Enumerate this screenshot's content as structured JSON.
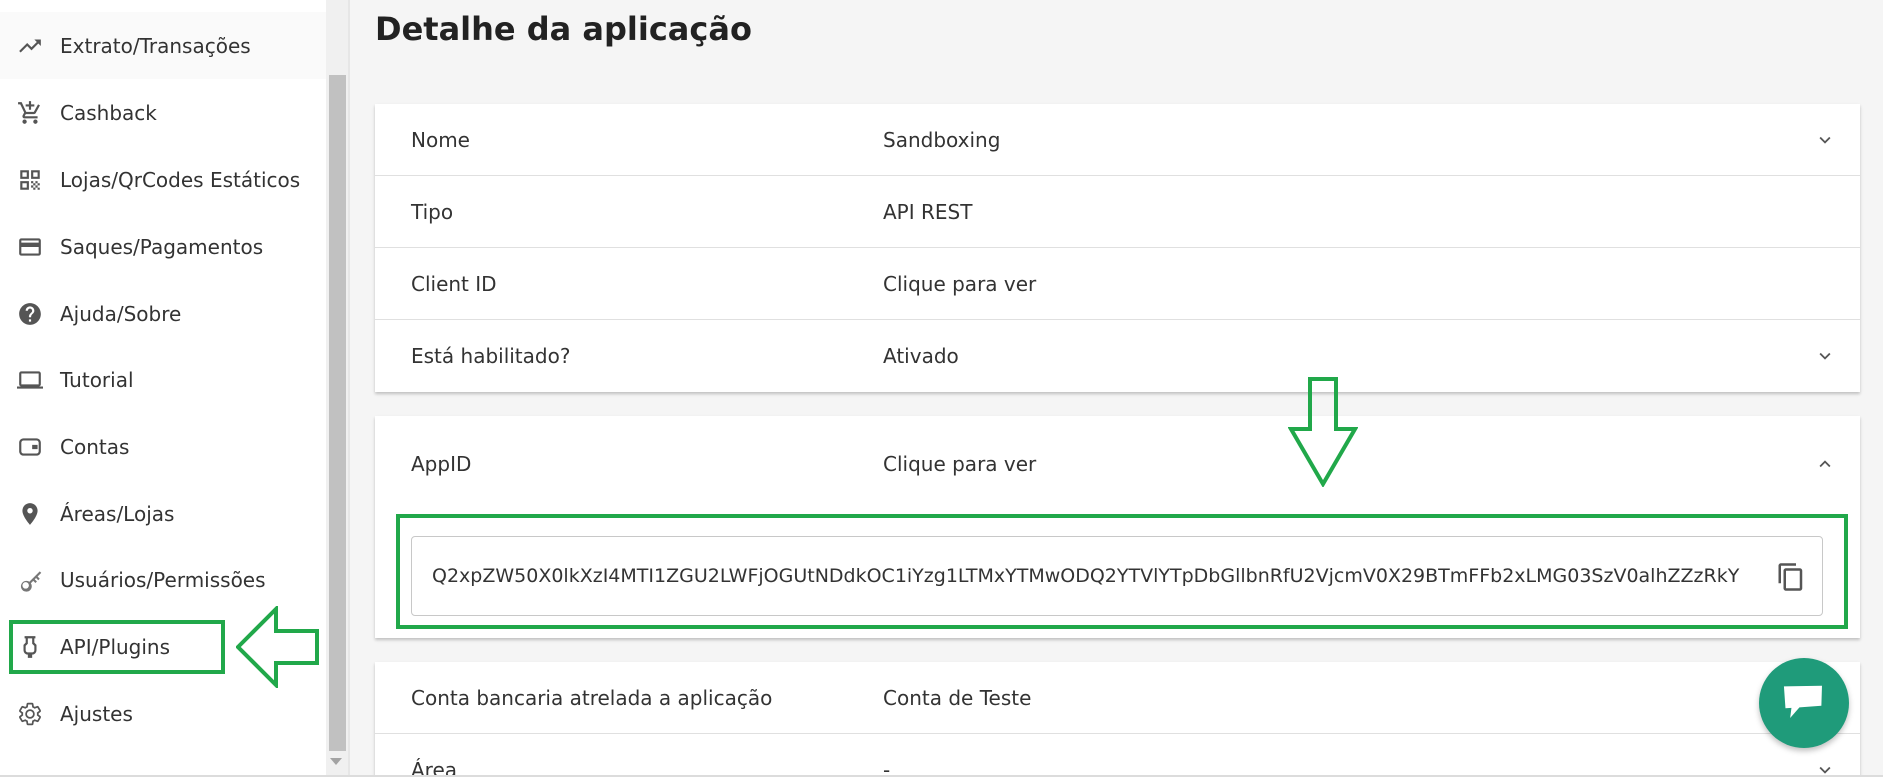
{
  "sidebar": {
    "items": [
      {
        "label": "Extrato/Transações",
        "icon": "trending-up-icon"
      },
      {
        "label": "Cashback",
        "icon": "cart-add-icon"
      },
      {
        "label": "Lojas/QrCodes Estáticos",
        "icon": "qr-code-icon"
      },
      {
        "label": "Saques/Pagamentos",
        "icon": "credit-card-icon"
      },
      {
        "label": "Ajuda/Sobre",
        "icon": "help-circle-icon"
      },
      {
        "label": "Tutorial",
        "icon": "laptop-icon"
      },
      {
        "label": "Contas",
        "icon": "wallet-icon"
      },
      {
        "label": "Áreas/Lojas",
        "icon": "location-pin-icon"
      },
      {
        "label": "Usuários/Permissões",
        "icon": "key-icon"
      },
      {
        "label": "API/Plugins",
        "icon": "plug-icon"
      },
      {
        "label": "Ajustes",
        "icon": "gear-icon"
      }
    ]
  },
  "main": {
    "title": "Detalhe da aplicação",
    "card1": {
      "rows": [
        {
          "label": "Nome",
          "value": "Sandboxing"
        },
        {
          "label": "Tipo",
          "value": "API REST"
        },
        {
          "label": "Client ID",
          "value": "Clique para ver"
        },
        {
          "label": "Está habilitado?",
          "value": "Ativado"
        }
      ]
    },
    "card2": {
      "label": "AppID",
      "value": "Clique para ver",
      "appid_value": "Q2xpZW50X0lkXzI4MTI1ZGU2LWFjOGUtNDdkOC1iYzg1LTMxYTMwODQ2YTVlYTpDbGllbnRfU2VjcmV0X29BTmFFb2xLMG03SzV0alhZZzRkY"
    },
    "card3": {
      "rows": [
        {
          "label": "Conta bancaria atrelada a aplicação",
          "value": "Conta de Teste"
        },
        {
          "label": "Área",
          "value": "-"
        }
      ]
    }
  },
  "colors": {
    "highlight": "#21a84a",
    "chat_fab": "#1f9b7a"
  },
  "icons": {
    "chevron_down": "chevron-down-icon",
    "chevron_up": "chevron-up-icon",
    "copy": "copy-icon",
    "chat": "chat-icon",
    "annotation_arrow_down": "arrow-down-icon",
    "annotation_arrow_left": "arrow-left-icon"
  }
}
